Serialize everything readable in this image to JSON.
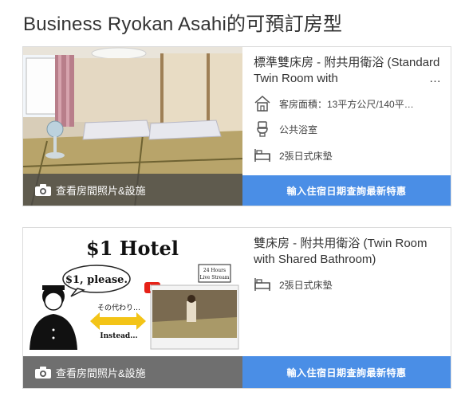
{
  "page": {
    "title": "Business Ryokan Asahi的可預訂房型"
  },
  "rooms": [
    {
      "name": "標準雙床房 - 附共用衛浴 (Standard Twin Room with",
      "name_overflow": "…",
      "photo_label": "查看房間照片&設施",
      "features": [
        {
          "icon": "house-icon",
          "text": "客房面積：13平方公尺/140平…"
        },
        {
          "icon": "toilet-icon",
          "text": "公共浴室"
        },
        {
          "icon": "bed-icon",
          "text": "2張日式床墊"
        }
      ],
      "cta": "輸入住宿日期查詢最新特惠"
    },
    {
      "name": "雙床房 - 附共用衛浴 (Twin Room with Shared Bathroom)",
      "photo_label": "查看房間照片&設施",
      "photo": {
        "heading": "$1 Hotel",
        "bubble": "$1, please.",
        "arrow_top": "その代わり…",
        "arrow_bottom": "Instead...",
        "stream_label_1": "24 Hours",
        "stream_label_2": "Live Stream"
      },
      "features": [
        {
          "icon": "bed-icon",
          "text": "2張日式床墊"
        }
      ],
      "cta": "輸入住宿日期查詢最新特惠"
    }
  ],
  "colors": {
    "accent": "#4a8ee6",
    "overlay": "#464646",
    "text": "#333333"
  }
}
